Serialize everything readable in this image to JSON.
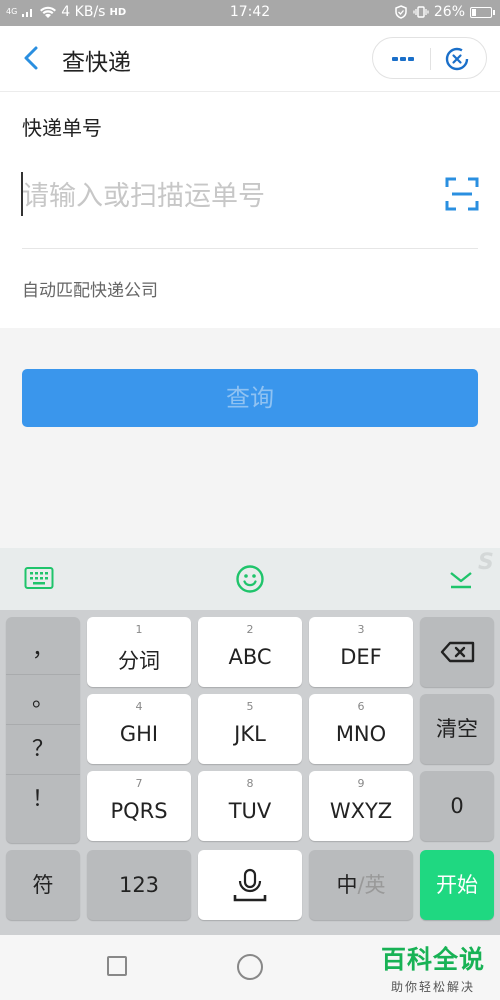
{
  "status_bar": {
    "network": "4G",
    "speed": "4 KB/s",
    "hd": "HD",
    "time": "17:42",
    "battery": "26%",
    "battery_level": 0.26
  },
  "header": {
    "title": "查快递",
    "icons": {
      "back": "chevron-left-icon",
      "more": "more-dots-icon",
      "close": "target-close-icon"
    }
  },
  "form": {
    "label": "快递单号",
    "input_value": "",
    "input_placeholder": "请输入或扫描运单号",
    "auto_match": "自动匹配快递公司",
    "scan_icon": "scan-icon"
  },
  "query_button": {
    "label": "查询"
  },
  "keyboard": {
    "toolbar_icons": [
      "keyboard-icon",
      "emoji-icon",
      "hide-keyboard-icon"
    ],
    "brand_mark": "S",
    "punctuation": [
      "，",
      "。",
      "？",
      "！"
    ],
    "row1": [
      {
        "num": "1",
        "label": "分词"
      },
      {
        "num": "2",
        "label": "ABC"
      },
      {
        "num": "3",
        "label": "DEF"
      }
    ],
    "row2": [
      {
        "num": "4",
        "label": "GHI"
      },
      {
        "num": "5",
        "label": "JKL"
      },
      {
        "num": "6",
        "label": "MNO"
      }
    ],
    "row3": [
      {
        "num": "7",
        "label": "PQRS"
      },
      {
        "num": "8",
        "label": "TUV"
      },
      {
        "num": "9",
        "label": "WXYZ"
      }
    ],
    "clear": "清空",
    "zero": "0",
    "symbols": "符",
    "numbers": "123",
    "lang_zh": "中",
    "lang_sep": "/",
    "lang_en": "英",
    "enter": "开始"
  },
  "watermark": {
    "title": "百科全说",
    "subtitle": "助你轻松解决"
  },
  "colors": {
    "accent": "#3a96ec",
    "enter_key": "#1fd881",
    "watermark": "#18b255",
    "emoji_icon": "#1fc46b"
  }
}
